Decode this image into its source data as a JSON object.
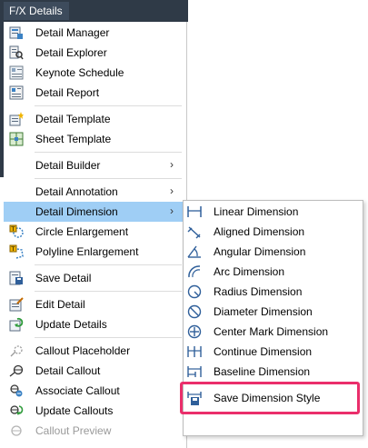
{
  "ribbon": {
    "tab_label": "F/X Details"
  },
  "menu": {
    "items": [
      {
        "label": "Detail Manager",
        "icon": "detail-manager-icon"
      },
      {
        "label": "Detail Explorer",
        "icon": "detail-explorer-icon"
      },
      {
        "label": "Keynote Schedule",
        "icon": "keynote-schedule-icon"
      },
      {
        "label": "Detail Report",
        "icon": "detail-report-icon"
      },
      {
        "label": "Detail Template",
        "icon": "detail-template-icon"
      },
      {
        "label": "Sheet Template",
        "icon": "sheet-template-icon"
      },
      {
        "label": "Detail Builder",
        "submenu": true
      },
      {
        "label": "Detail Annotation",
        "submenu": true
      },
      {
        "label": "Detail Dimension",
        "submenu": true,
        "highlighted": true
      },
      {
        "label": "Circle Enlargement",
        "icon": "circle-enlargement-icon"
      },
      {
        "label": "Polyline Enlargement",
        "icon": "polyline-enlargement-icon"
      },
      {
        "label": "Save Detail",
        "icon": "save-detail-icon"
      },
      {
        "label": "Edit Detail",
        "icon": "edit-detail-icon"
      },
      {
        "label": "Update Details",
        "icon": "update-details-icon"
      },
      {
        "label": "Callout Placeholder",
        "icon": "callout-placeholder-icon"
      },
      {
        "label": "Detail Callout",
        "icon": "detail-callout-icon"
      },
      {
        "label": "Associate Callout",
        "icon": "associate-callout-icon"
      },
      {
        "label": "Update Callouts",
        "icon": "update-callouts-icon"
      },
      {
        "label": "Callout Preview",
        "icon": "callout-preview-icon",
        "disabled": true
      }
    ],
    "submenu_arrow": "›"
  },
  "submenu": {
    "items": [
      {
        "label": "Linear Dimension",
        "icon": "linear-dimension-icon"
      },
      {
        "label": "Aligned Dimension",
        "icon": "aligned-dimension-icon"
      },
      {
        "label": "Angular Dimension",
        "icon": "angular-dimension-icon"
      },
      {
        "label": "Arc Dimension",
        "icon": "arc-dimension-icon"
      },
      {
        "label": "Radius Dimension",
        "icon": "radius-dimension-icon"
      },
      {
        "label": "Diameter Dimension",
        "icon": "diameter-dimension-icon"
      },
      {
        "label": "Center Mark Dimension",
        "icon": "center-mark-dimension-icon"
      },
      {
        "label": "Continue Dimension",
        "icon": "continue-dimension-icon"
      },
      {
        "label": "Baseline Dimension",
        "icon": "baseline-dimension-icon"
      },
      {
        "label": "Save Dimension Style",
        "icon": "save-dimension-style-icon"
      }
    ]
  },
  "colors": {
    "highlight": "#9fcef5",
    "annotation_box": "#ea2e6b",
    "chrome": "#2f3a47"
  }
}
